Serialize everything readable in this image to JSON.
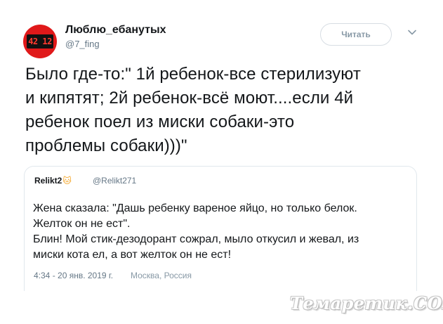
{
  "author": {
    "avatar_display": "42 12",
    "display_name": "Люблю_ебанутых",
    "screen_name": "@7_fing",
    "avatar_color": "#e0191a"
  },
  "header": {
    "follow_label": "Читать",
    "menu_icon": "chevron-down-icon"
  },
  "tweet": {
    "lines": [
      "Было где-то:\" 1й ребенок-все стерилизуют",
      "и кипятят; 2й ребенок-всё моют....если 4й",
      "ребенок поел из миски собаки-это",
      "проблемы собаки)))\""
    ]
  },
  "quote": {
    "name": "Relikt2",
    "name_emoji": "🐱",
    "handle": "@Relikt271",
    "lines": [
      "Жена сказала: \"Дашь ребенку вареное яйцо, но только белок.",
      "Желток он не ест\".",
      "Блин! Мой стик-дезодорант сожрал, мыло откусил и жевал, из",
      "миски кота ел, а вот желток он не ест!"
    ]
  },
  "meta": {
    "timestamp": "4:34 - 20 янв. 2019 г.",
    "location": "Москва, Россия"
  },
  "watermark": "Темаретик.COM",
  "colors": {
    "text": "#14171a",
    "secondary": "#657786",
    "border": "#e1e8ed"
  }
}
